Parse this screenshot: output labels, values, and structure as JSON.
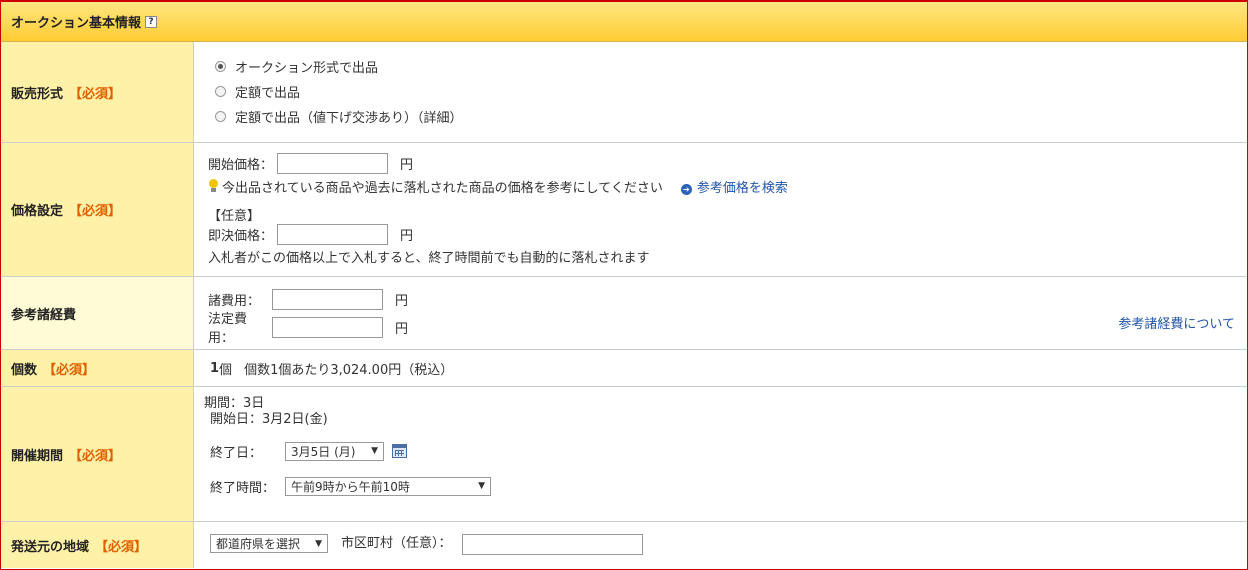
{
  "header": {
    "title": "オークション基本情報",
    "help_icon": "?"
  },
  "required_tag": "【必須】",
  "sales_format": {
    "label": "販売形式",
    "options": [
      "オークション形式で出品",
      "定額で出品",
      "定額で出品（値下げ交渉あり）（詳細）"
    ],
    "selected": 0
  },
  "price": {
    "label": "価格設定",
    "start_label": "開始価格：",
    "start_value": "",
    "yen": "円",
    "hint": "今出品されている商品や過去に落札された商品の価格を参考にしてください",
    "search_link": "参考価格を検索",
    "optional": "【任意】",
    "buyout_label": "即決価格：",
    "buyout_value": "",
    "buyout_note": "入札者がこの価格以上で入札すると、終了時間前でも自動的に落札されます"
  },
  "fees": {
    "label": "参考諸経費",
    "misc_label": "諸費用：",
    "legal_label": "法定費用：",
    "yen": "円",
    "about_link": "参考諸経費について"
  },
  "quantity": {
    "label": "個数",
    "count": "1",
    "unit": "個",
    "per_unit": "個数1個あたり3,024.00円（税込）"
  },
  "period": {
    "label": "開催期間",
    "duration": "期間：3日",
    "start": "開始日：3月2日(金)",
    "end_date_label": "終了日：",
    "end_date_value": "3月5日 (月)",
    "end_time_label": "終了時間：",
    "end_time_value": "午前9時から午前10時"
  },
  "origin": {
    "label": "発送元の地域",
    "prefecture_select": "都道府県を選択",
    "city_label": "市区町村（任意）：",
    "city_value": ""
  },
  "colors": {
    "header_bg": "#ffcc33",
    "label_bg": "#fff2a8",
    "required": "#e06000",
    "link": "#2255aa",
    "frame_border": "#cc0000"
  }
}
